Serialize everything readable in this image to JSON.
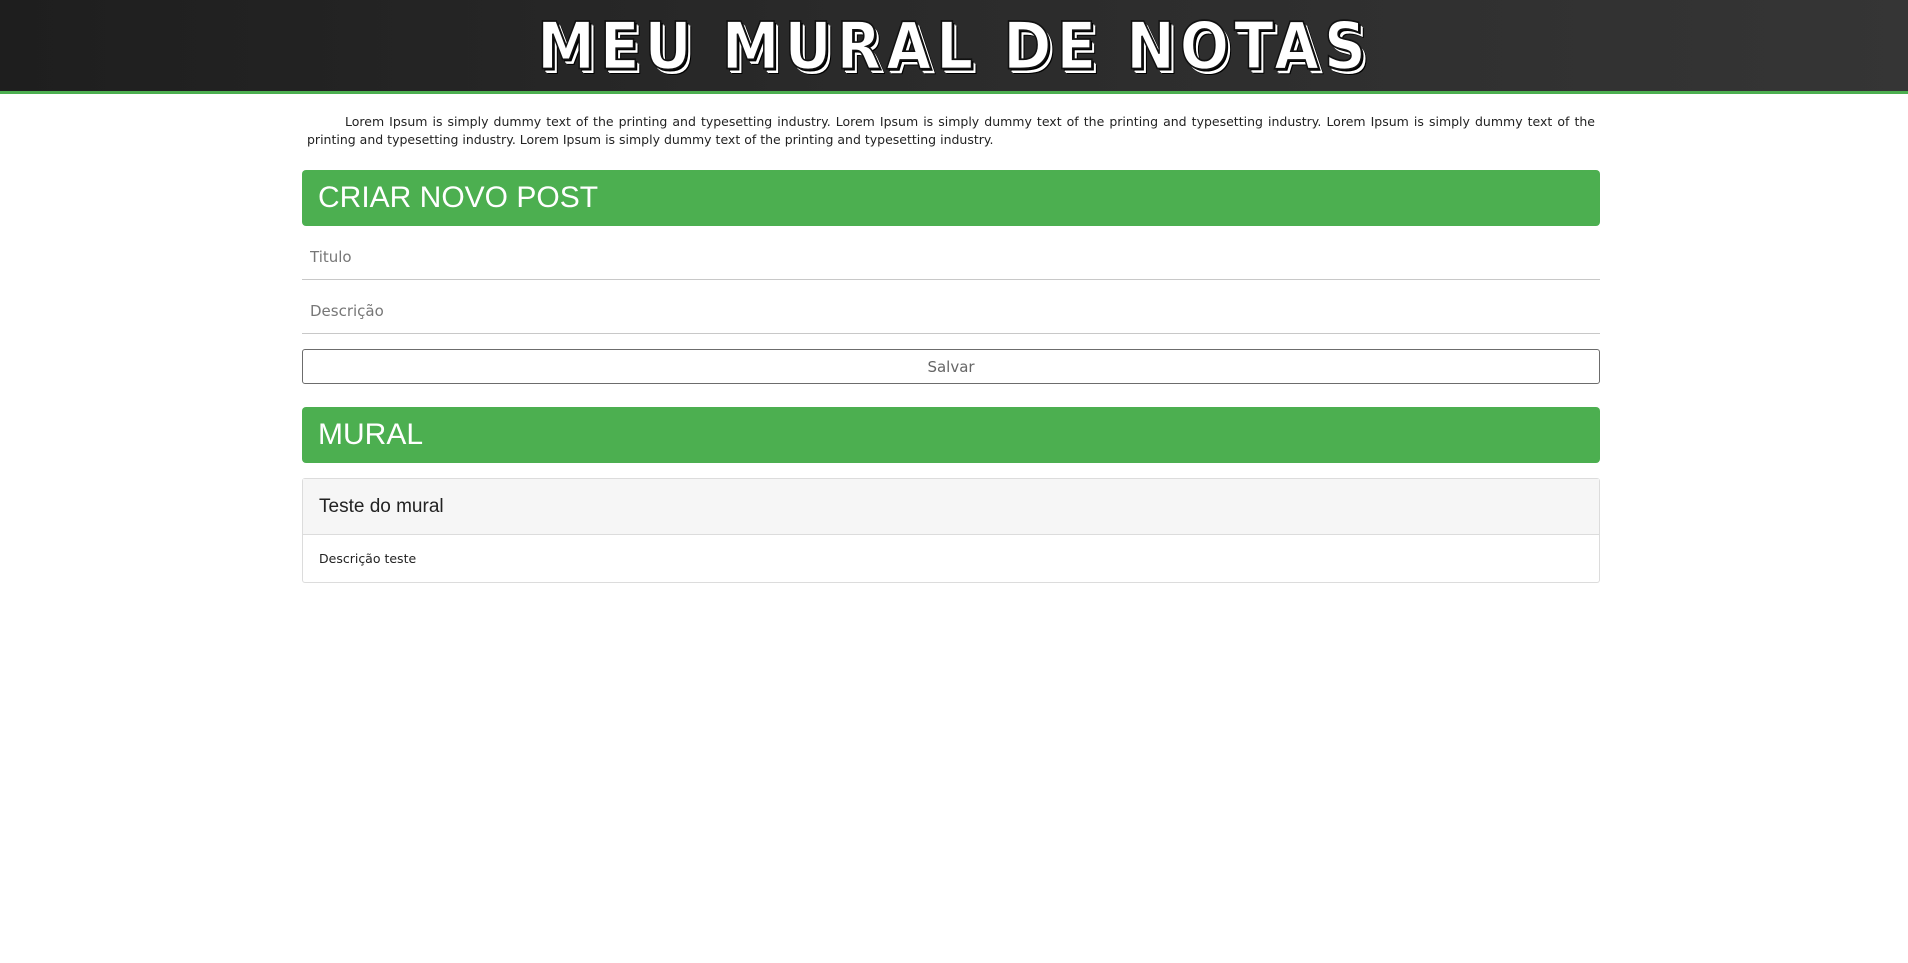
{
  "header": {
    "title": "MEU MURAL DE NOTAS",
    "accent_color": "#4caf50"
  },
  "intro": {
    "text": "Lorem Ipsum is simply dummy text of the printing and typesetting industry. Lorem Ipsum is simply dummy text of the printing and typesetting industry. Lorem Ipsum is simply dummy text of the printing and typesetting industry. Lorem Ipsum is simply dummy text of the printing and typesetting industry."
  },
  "create_post": {
    "heading": "CRIAR NOVO POST",
    "title_field": {
      "value": "",
      "placeholder": "Titulo"
    },
    "description_field": {
      "value": "",
      "placeholder": "Descrição"
    },
    "save_label": "Salvar"
  },
  "mural": {
    "heading": "MURAL",
    "posts": [
      {
        "title": "Teste do mural",
        "description": "Descrição teste"
      }
    ]
  }
}
